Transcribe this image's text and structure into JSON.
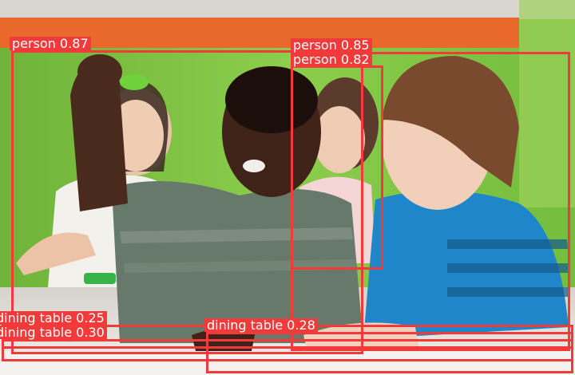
{
  "image": {
    "description_colors": {
      "wall_green": "#7cc243",
      "wall_orange": "#e9682b",
      "shirt_blue": "#1f87c9",
      "shirt_green": "#67796a",
      "table": "#e4e2dc",
      "box_color": "#f23a3a"
    }
  },
  "detections": [
    {
      "label": "person",
      "score": "0.87",
      "text": "person 0.87"
    },
    {
      "label": "person",
      "score": "0.85",
      "text": "person 0.85"
    },
    {
      "label": "person",
      "score": "0.82",
      "text": "person 0.82"
    },
    {
      "label": "dining table",
      "score": "0.25",
      "text": "dining table 0.25"
    },
    {
      "label": "dining table",
      "score": "0.30",
      "text": "dining table 0.30"
    },
    {
      "label": "dining table",
      "score": "0.28",
      "text": "dining table 0.28"
    }
  ]
}
